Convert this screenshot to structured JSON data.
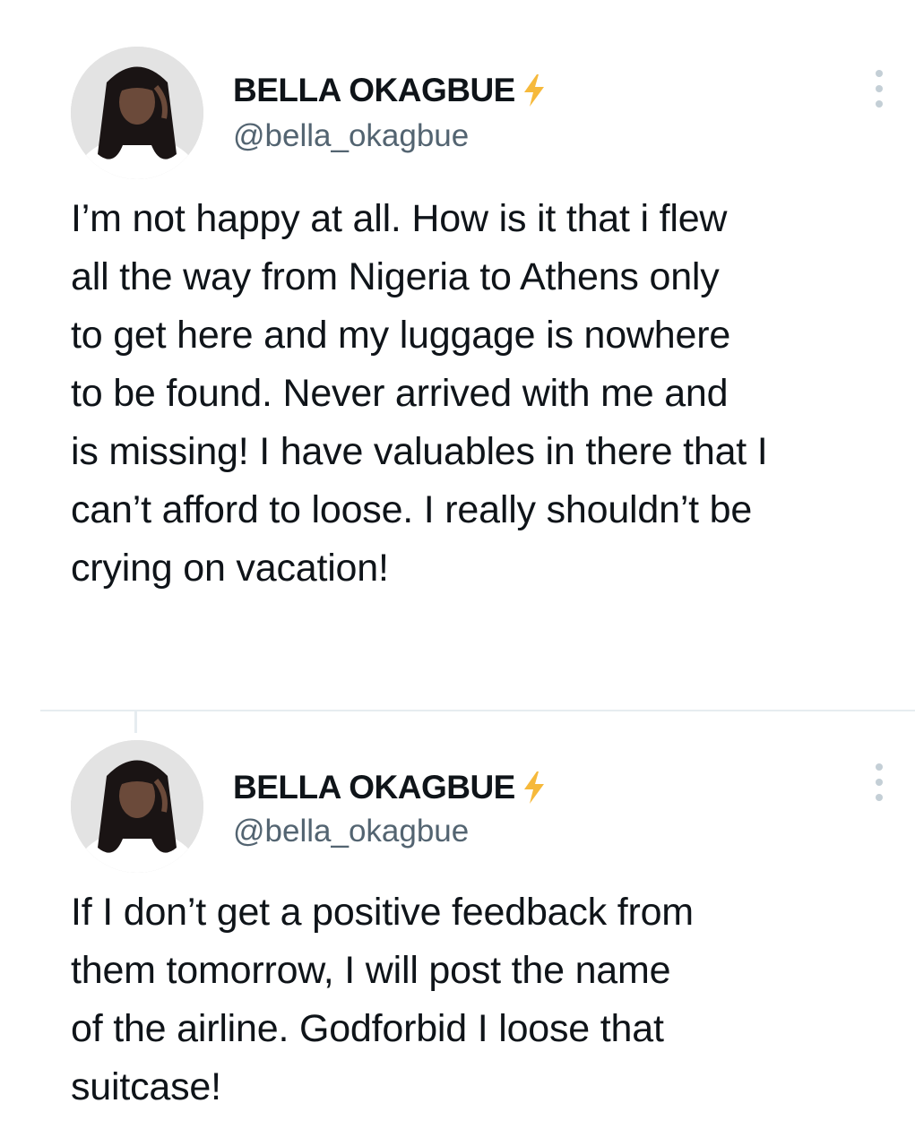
{
  "tweets": [
    {
      "display_name": "BELLA OKAGBUE",
      "handle": "@bella_okagbue",
      "badge_icon": "lightning-bolt-icon",
      "menu_icon": "more-vertical-icon",
      "text_lines": [
        "I’m not happy at all. How is it that i flew",
        "all the way from Nigeria to Athens only",
        "to get here and my luggage is nowhere",
        "to be found. Never arrived with me and",
        "is missing! I have valuables in there that I",
        "can’t afford to loose. I really shouldn’t be",
        "crying on vacation!"
      ]
    },
    {
      "display_name": "BELLA OKAGBUE",
      "handle": "@bella_okagbue",
      "badge_icon": "lightning-bolt-icon",
      "menu_icon": "more-vertical-icon",
      "text_lines": [
        "If I don’t get a positive feedback from",
        "them tomorrow, I will post the name",
        "of the airline. Godforbid I loose that",
        "suitcase!"
      ]
    }
  ],
  "colors": {
    "text_primary": "#0f1419",
    "text_secondary": "#536471",
    "badge": "#f6b93b",
    "divider": "#e6ecf0"
  }
}
